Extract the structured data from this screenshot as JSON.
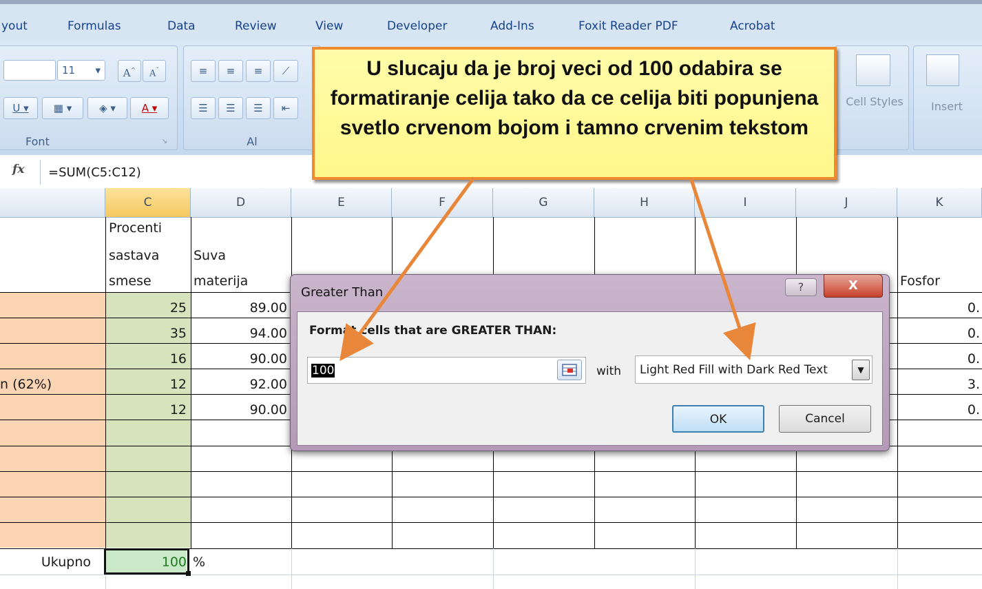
{
  "ribbon": {
    "tabs": [
      "yout",
      "Formulas",
      "Data",
      "Review",
      "View",
      "Developer",
      "Add-Ins",
      "Foxit Reader PDF",
      "Acrobat"
    ],
    "font_size": "11",
    "group_font_label": "Font",
    "group_align_label": "Al",
    "cell_styles_label": "Cell Styles",
    "insert_label": "Insert"
  },
  "formula_bar": {
    "fx_symbol": "fx",
    "formula": "=SUM(C5:C12)"
  },
  "columns": [
    "C",
    "D",
    "E",
    "F",
    "G",
    "H",
    "I",
    "J",
    "K"
  ],
  "header_row": {
    "c": [
      "Procenti",
      "sastava",
      "smese"
    ],
    "d": [
      "Suva",
      "materija"
    ],
    "k": "Fosfor"
  },
  "rows": [
    {
      "b": "",
      "c": "25",
      "d": "89.00",
      "k": "0."
    },
    {
      "b": "",
      "c": "35",
      "d": "94.00",
      "k": "0."
    },
    {
      "b": "",
      "c": "16",
      "d": "90.00",
      "k": "0."
    },
    {
      "b": "n (62%)",
      "c": "12",
      "d": "92.00",
      "k": "3."
    },
    {
      "b": "",
      "c": "12",
      "d": "90.00",
      "k": "0."
    }
  ],
  "total_row": {
    "label": "Ukupno",
    "value": "100",
    "unit": "%"
  },
  "dialog": {
    "title": "Greater Than",
    "help": "?",
    "close": "X",
    "label": "Format cells that are GREATER THAN:",
    "value": "100",
    "with": "with",
    "format_option": "Light Red Fill with Dark Red Text",
    "ok": "OK",
    "cancel": "Cancel"
  },
  "callout": {
    "text": "U slucaju da je broj veci od 100 odabira se formatiranje celija tako da ce celija biti popunjena svetlo crvenom bojom i tamno crvenim tekstom"
  },
  "colors": {
    "selected_column": "#f6c85f",
    "label_fill": "#fbd4b4",
    "values_fill": "#d6e3bc",
    "callout_fill": "#fff78a",
    "callout_border": "#f08c2e",
    "arrow": "#e8873a"
  }
}
